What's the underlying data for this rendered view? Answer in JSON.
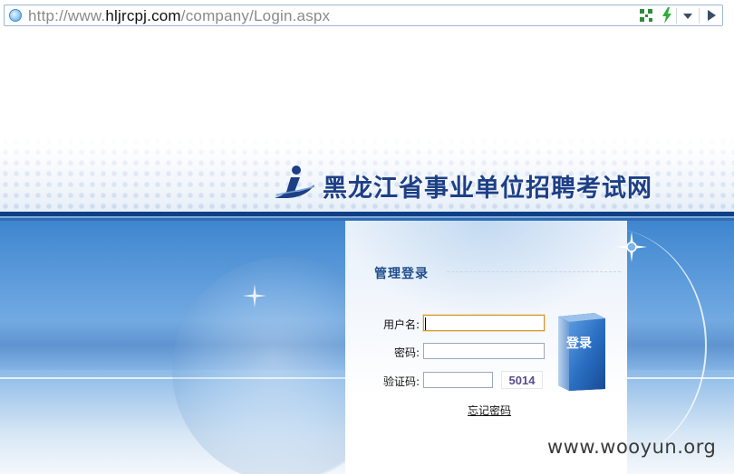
{
  "browser": {
    "url_prefix": "http://www.",
    "url_host": "hljrcpj.com",
    "url_path": "/company/Login.aspx",
    "icons": [
      "globe-icon",
      "qr-code-icon",
      "lightning-icon",
      "dropdown-icon",
      "go-icon"
    ]
  },
  "banner": {
    "site_title": "黑龙江省事业单位招聘考试网",
    "logo_icon": "person-logo-icon"
  },
  "login": {
    "title": "管理登录",
    "username_label": "用户名:",
    "password_label": "密码:",
    "captcha_label": "验证码:",
    "username_value": "",
    "password_value": "",
    "captcha_input_value": "",
    "captcha_code": "5014",
    "submit_label": "登录",
    "forgot_link": "忘记密码"
  },
  "watermark": "www.wooyun.org",
  "colors": {
    "title_blue": "#1d3f86",
    "stripe_navy": "#0f3f85",
    "focus_orange": "#d39a2a",
    "captcha_text": "#5a4e8c"
  }
}
